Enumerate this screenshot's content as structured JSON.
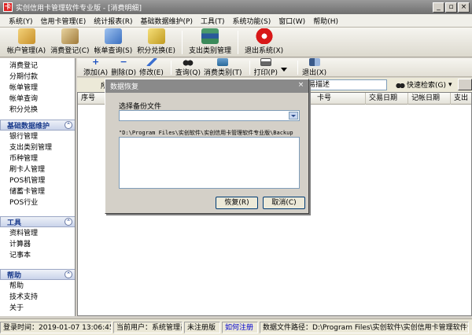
{
  "window": {
    "icon": "卡",
    "title": "实创信用卡管理软件专业版 - [消费明细]",
    "minimize": "_",
    "restore": "▫",
    "close": "×"
  },
  "menu": [
    "系统(Y)",
    "信用卡管理(E)",
    "统计报表(R)",
    "基础数据维护(P)",
    "工具(T)",
    "系统功能(S)",
    "窗口(W)",
    "帮助(H)"
  ],
  "toolbar": [
    {
      "label": "帐户管理(A)",
      "icon": "account-icon",
      "color": "#e8b84a"
    },
    {
      "label": "消费登记(C)",
      "icon": "register-icon",
      "color": "#c9a15a"
    },
    {
      "label": "帐单查询(S)",
      "icon": "bill-query-icon",
      "color": "#5a8fd6"
    },
    {
      "label": "积分兑换(E)",
      "icon": "points-icon",
      "color": "#e0c040"
    },
    {
      "label": "支出类别管理",
      "icon": "books-icon",
      "color": "#3a8a5a"
    },
    {
      "label": "退出系统(X)",
      "icon": "exit-icon",
      "color": "#d81818"
    }
  ],
  "nav": {
    "top_items": [
      "消费登记",
      "分期付款",
      "帐单管理",
      "帐单查询",
      "积分兑换"
    ],
    "sections": [
      {
        "title": "基础数据维护",
        "items": [
          "银行管理",
          "支出类别管理",
          "币种管理",
          "刷卡人管理",
          "POS机管理",
          "储蓄卡管理",
          "POS行业"
        ]
      },
      {
        "title": "工具",
        "items": [
          "资料管理",
          "计算器",
          "记事本"
        ]
      },
      {
        "title": "帮助",
        "items": [
          "帮助",
          "技术支持",
          "关于"
        ]
      }
    ]
  },
  "subtoolbar": [
    {
      "label": "添加(A)",
      "icon": "add-icon",
      "color": "#1a4fc0"
    },
    {
      "label": "删除(D)",
      "icon": "delete-icon",
      "color": "#1a4fc0"
    },
    {
      "label": "修改(E)",
      "icon": "edit-icon",
      "color": "#3a6fd0"
    },
    {
      "label": "查询(Q)",
      "icon": "binoculars-icon",
      "color": "#222222"
    },
    {
      "label": "消费类别(T)",
      "icon": "category-icon",
      "color": "#2a6a9a"
    },
    {
      "label": "打印(P)",
      "icon": "print-icon",
      "color": "#555555"
    },
    {
      "label": "退出(X)",
      "icon": "exit-door-icon",
      "color": "#3a5a8a"
    }
  ],
  "search": {
    "label": "所",
    "field_value": "易描述",
    "quick_search": "快速检索(G)",
    "quick_arrow": "▾"
  },
  "table": {
    "columns": [
      "序号",
      "卡号",
      "交易日期",
      "记帐日期",
      "支出"
    ]
  },
  "dialog": {
    "title": "数据恢复",
    "close": "×",
    "file_label": "选择备份文件",
    "path": "\"D:\\Program Files\\实创软件\\实创信用卡管理软件专业版\\Backup",
    "restore_button": "恢复(R)",
    "cancel_button": "取消(C)"
  },
  "status": {
    "login_time": "登录时间：2019-01-07 13:06:45",
    "user": "当前用户：系统管理员",
    "registration": "未注册版",
    "register_link": "如何注册",
    "data_path": "数据文件路径：D:\\Program Files\\实创软件\\实创信用卡管理软件专业版"
  }
}
